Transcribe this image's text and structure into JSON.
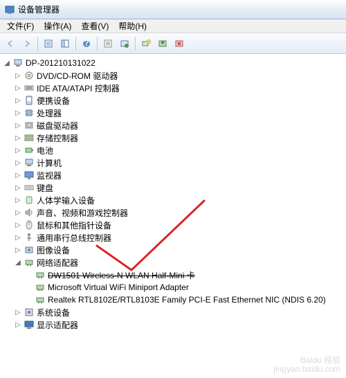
{
  "window": {
    "title": "设备管理器"
  },
  "menu": {
    "file": "文件(F)",
    "action": "操作(A)",
    "view": "查看(V)",
    "help": "帮助(H)"
  },
  "root": "DP-201210131022",
  "cats": [
    {
      "icon": "disc",
      "label": "DVD/CD-ROM 驱动器"
    },
    {
      "icon": "ide",
      "label": "IDE ATA/ATAPI 控制器"
    },
    {
      "icon": "port",
      "label": "便携设备"
    },
    {
      "icon": "cpu",
      "label": "处理器"
    },
    {
      "icon": "disk",
      "label": "磁盘驱动器"
    },
    {
      "icon": "stor",
      "label": "存储控制器"
    },
    {
      "icon": "batt",
      "label": "电池"
    },
    {
      "icon": "pc",
      "label": "计算机"
    },
    {
      "icon": "mon",
      "label": "监视器"
    },
    {
      "icon": "kbd",
      "label": "键盘"
    },
    {
      "icon": "hid",
      "label": "人体学输入设备"
    },
    {
      "icon": "snd",
      "label": "声音、视频和游戏控制器"
    },
    {
      "icon": "mouse",
      "label": "鼠标和其他指针设备"
    },
    {
      "icon": "usb",
      "label": "通用串行总线控制器"
    },
    {
      "icon": "img",
      "label": "图像设备"
    }
  ],
  "net": {
    "label": "网络适配器",
    "items": [
      {
        "label": "DW1501 Wireless-N WLAN Half-Mini 卡",
        "strike": true
      },
      {
        "label": "Microsoft Virtual WiFi Miniport Adapter",
        "strike": false
      },
      {
        "label": "Realtek RTL8102E/RTL8103E Family PCI-E Fast Ethernet NIC (NDIS 6.20)",
        "strike": false
      }
    ]
  },
  "tail": [
    {
      "icon": "sys",
      "label": "系统设备"
    },
    {
      "icon": "disp",
      "label": "显示适配器"
    }
  ],
  "watermark": {
    "l1": "Baidu 经验",
    "l2": "jingyan.baidu.com"
  }
}
